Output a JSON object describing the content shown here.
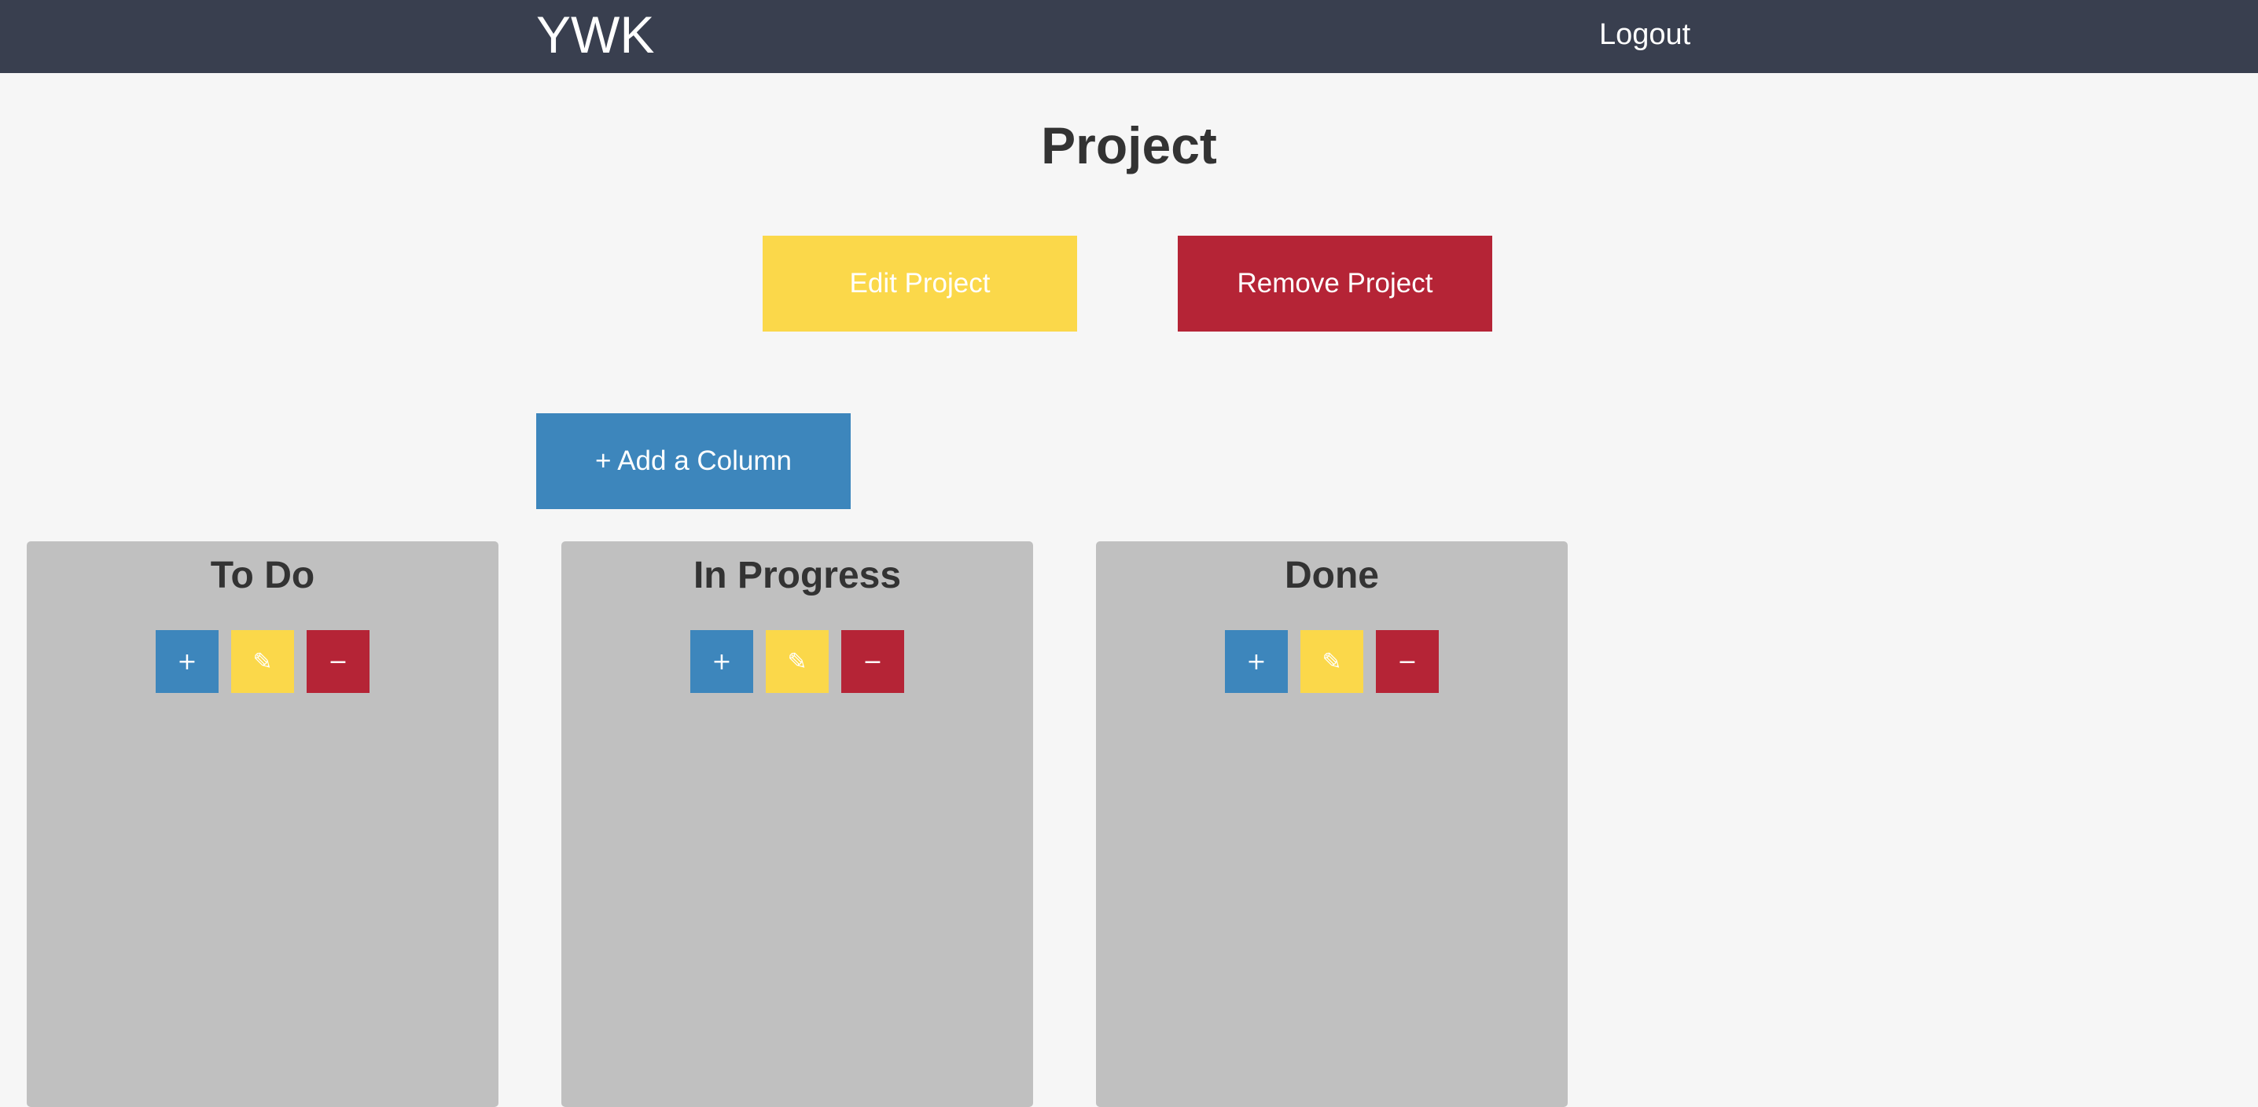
{
  "navbar": {
    "brand": "YWK",
    "logout_label": "Logout"
  },
  "page": {
    "title": "Project"
  },
  "actions": {
    "edit_project_label": "Edit Project",
    "remove_project_label": "Remove Project",
    "add_column_label": "+ Add a Column"
  },
  "columns": [
    {
      "title": "To Do",
      "add_label": "+",
      "edit_label": "✎",
      "remove_label": "−"
    },
    {
      "title": "In Progress",
      "add_label": "+",
      "edit_label": "✎",
      "remove_label": "−"
    },
    {
      "title": "Done",
      "add_label": "+",
      "edit_label": "✎",
      "remove_label": "−"
    }
  ],
  "colors": {
    "navbar": "#393f4f",
    "background": "#f6f6f6",
    "primary_blue": "#3d86bc",
    "warning_yellow": "#fbd84a",
    "danger_red": "#b52436",
    "column_gray": "#c0c0c0"
  },
  "icons": {
    "add": "plus-icon",
    "edit": "pencil-icon",
    "remove": "minus-icon"
  }
}
